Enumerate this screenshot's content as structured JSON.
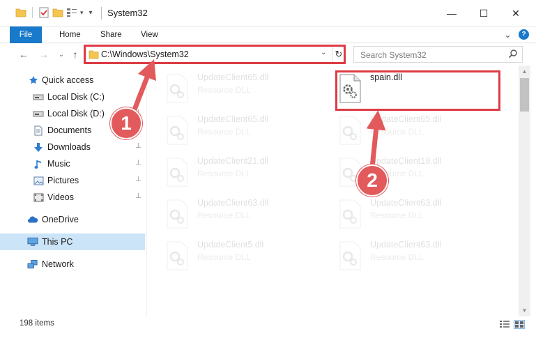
{
  "window": {
    "title": "System32",
    "minimize_glyph": "—",
    "maximize_glyph": "☐",
    "close_glyph": "✕"
  },
  "ribbon": {
    "tabs": [
      "File",
      "Home",
      "Share",
      "View"
    ],
    "expand_glyph": "⌄",
    "help_glyph": "?"
  },
  "address_bar": {
    "path": "C:\\Windows\\System32",
    "dropdown_glyph": "⌄",
    "refresh_glyph": "↻"
  },
  "search": {
    "placeholder": "Search System32"
  },
  "nav_buttons": {
    "back": "←",
    "forward": "→",
    "recent": "⌄",
    "up": "↑"
  },
  "sidebar": {
    "items": [
      {
        "label": "Quick access",
        "icon": "star-icon",
        "pinned": false
      },
      {
        "label": "Local Disk (C:)",
        "icon": "drive-icon",
        "pinned": true
      },
      {
        "label": "Local Disk (D:)",
        "icon": "drive-icon",
        "pinned": true
      },
      {
        "label": "Documents",
        "icon": "documents-icon",
        "pinned": true
      },
      {
        "label": "Downloads",
        "icon": "download-arrow-icon",
        "pinned": true
      },
      {
        "label": "Music",
        "icon": "music-note-icon",
        "pinned": true
      },
      {
        "label": "Pictures",
        "icon": "pictures-icon",
        "pinned": true
      },
      {
        "label": "Videos",
        "icon": "videos-icon",
        "pinned": true
      },
      {
        "label": "OneDrive",
        "icon": "cloud-icon",
        "pinned": false
      },
      {
        "label": "This PC",
        "icon": "computer-icon",
        "pinned": false
      },
      {
        "label": "Network",
        "icon": "network-icon",
        "pinned": false
      }
    ],
    "pin_glyph": "📌"
  },
  "files": [
    {
      "name": "UpdateClient65.dll",
      "type": "Resource DLL",
      "highlighted": false
    },
    {
      "name": "spain.dll",
      "type": "",
      "highlighted": true
    },
    {
      "name": "UpdateClient65.dll",
      "type": "Resource DLL",
      "highlighted": false
    },
    {
      "name": "UpdateClient65.dll",
      "type": "Resource DLL",
      "highlighted": false
    },
    {
      "name": "UpdateClient21.dll",
      "type": "Resource DLL",
      "highlighted": false
    },
    {
      "name": "UpdateClient19.dll",
      "type": "Resource DLL",
      "highlighted": false
    },
    {
      "name": "UpdateClient63.dll",
      "type": "Resource DLL",
      "highlighted": false
    },
    {
      "name": "UpdateClient63.dll",
      "type": "Resource DLL",
      "highlighted": false
    },
    {
      "name": "UpdateClient5.dll",
      "type": "Resource DLL",
      "highlighted": false
    },
    {
      "name": "UpdateClient63.dll",
      "type": "Resource DLL",
      "highlighted": false
    }
  ],
  "status": {
    "item_count": "198 items"
  },
  "annotations": {
    "step1": "1",
    "step2": "2",
    "color": "#dd3b45"
  },
  "colors": {
    "file_tab": "#1979ca",
    "selection": "#cce4f7",
    "folder": "#f4c550"
  }
}
